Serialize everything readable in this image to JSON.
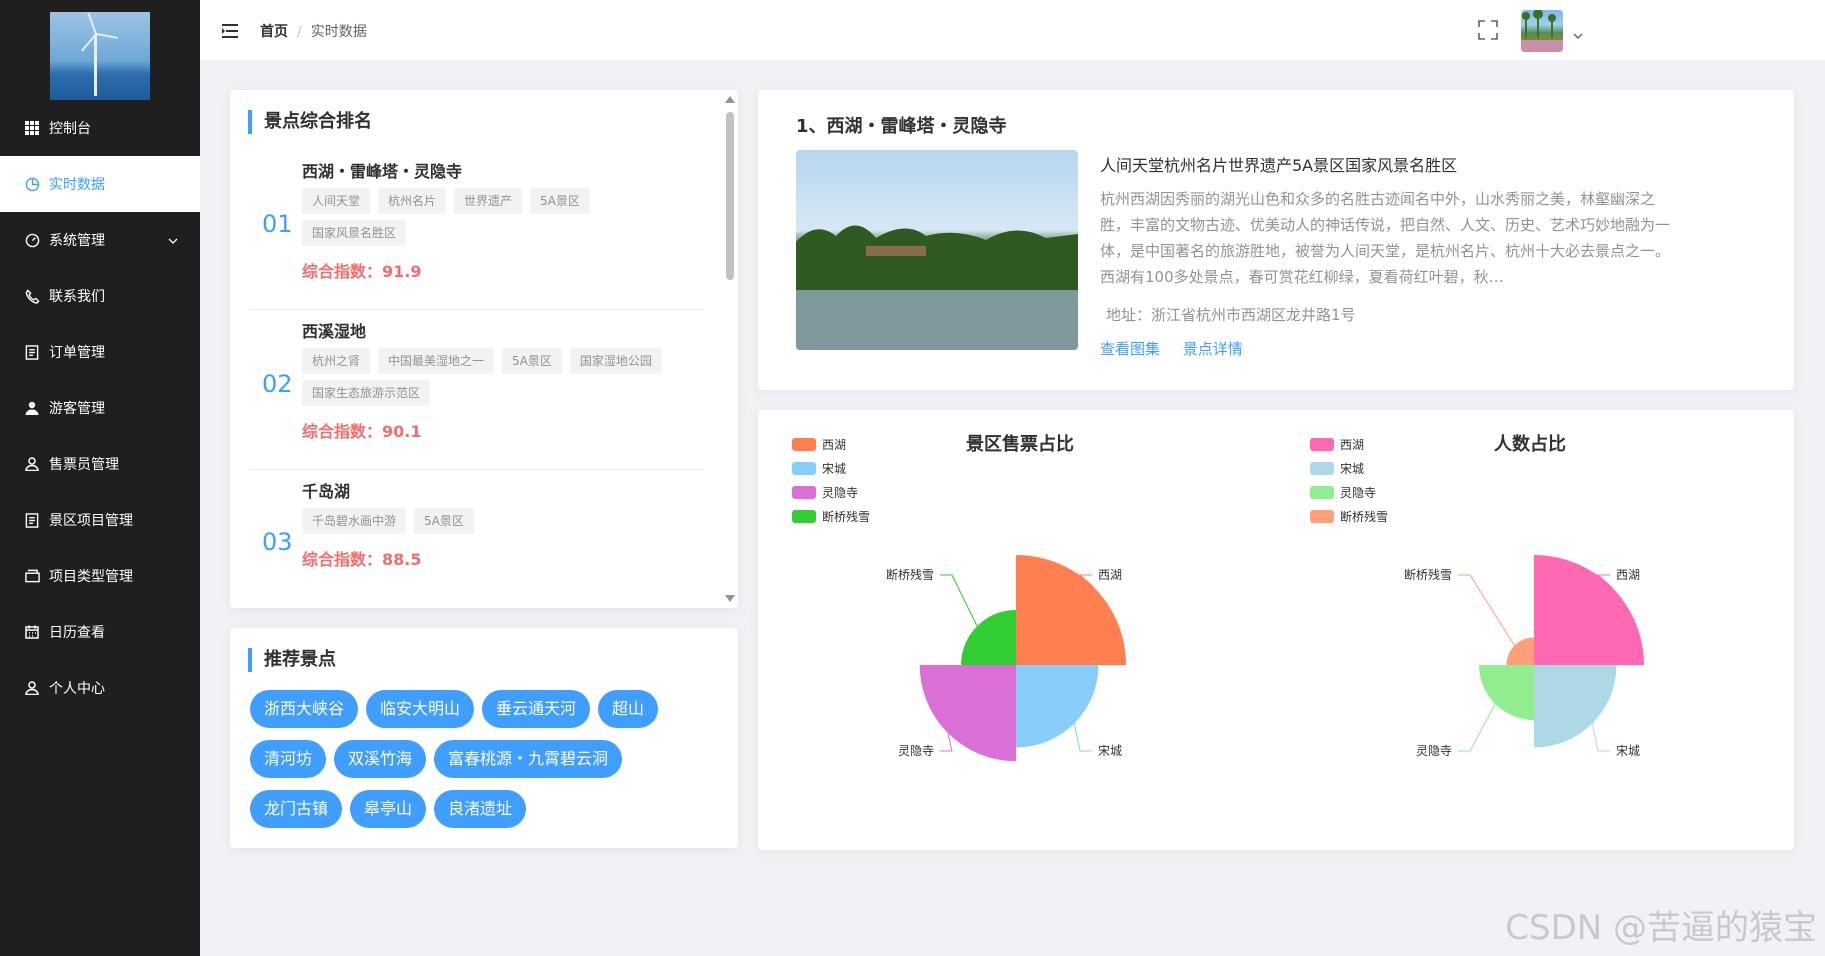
{
  "sidebar": {
    "items": [
      {
        "label": "控制台",
        "icon": "grid-icon"
      },
      {
        "label": "实时数据",
        "icon": "pie-icon",
        "active": true
      },
      {
        "label": "系统管理",
        "icon": "dashboard-icon",
        "has_submenu": true
      },
      {
        "label": "联系我们",
        "icon": "phone-icon"
      },
      {
        "label": "订单管理",
        "icon": "document-icon"
      },
      {
        "label": "游客管理",
        "icon": "user-solid-icon"
      },
      {
        "label": "售票员管理",
        "icon": "user-icon"
      },
      {
        "label": "景区项目管理",
        "icon": "document-icon"
      },
      {
        "label": "项目类型管理",
        "icon": "box-icon"
      },
      {
        "label": "日历查看",
        "icon": "calendar-icon"
      },
      {
        "label": "个人中心",
        "icon": "user-icon"
      }
    ]
  },
  "breadcrumb": {
    "home": "首页",
    "separator": "/",
    "current": "实时数据"
  },
  "ranking": {
    "title": "景点综合排名",
    "items": [
      {
        "num": "01",
        "name": "西湖・雷峰塔・灵隐寺",
        "tags": [
          "人间天堂",
          "杭州名片",
          "世界遗产",
          "5A景区",
          "国家风景名胜区"
        ],
        "score": "综合指数：91.9"
      },
      {
        "num": "02",
        "name": "西溪湿地",
        "tags": [
          "杭州之肾",
          "中国最美湿地之一",
          "5A景区",
          "国家湿地公园",
          "国家生态旅游示范区"
        ],
        "score": "综合指数：90.1"
      },
      {
        "num": "03",
        "name": "千岛湖",
        "tags": [
          "千岛碧水画中游",
          "5A景区"
        ],
        "score": "综合指数：88.5"
      }
    ]
  },
  "recommend": {
    "title": "推荐景点",
    "items": [
      "浙西大峡谷",
      "临安大明山",
      "垂云通天河",
      "超山",
      "清河坊",
      "双溪竹海",
      "富春桃源・九霄碧云洞",
      "龙门古镇",
      "皋亭山",
      "良渚遗址"
    ]
  },
  "detail": {
    "title": "1、西湖・雷峰塔・灵隐寺",
    "slogan": "人间天堂杭州名片世界遗产5A景区国家风景名胜区",
    "description": "杭州西湖因秀丽的湖光山色和众多的名胜古迹闻名中外，山水秀丽之美，林壑幽深之胜，丰富的文物古迹、优美动人的神话传说，把自然、人文、历史、艺术巧妙地融为一体，是中国著名的旅游胜地，被誉为人间天堂，是杭州名片、杭州十大必去景点之一。西湖有100多处景点，春可赏花红柳绿，夏看荷红叶碧，秋…",
    "address": "地址：浙江省杭州市西湖区龙井路1号",
    "links": [
      "查看图集",
      "景点详情"
    ]
  },
  "chart_data": [
    {
      "type": "pie",
      "subtype": "rose",
      "title": "景区售票占比",
      "legend_position": "top-left",
      "categories": [
        "西湖",
        "宋城",
        "灵隐寺",
        "断桥残雪"
      ],
      "values": [
        40,
        30,
        35,
        20
      ],
      "colors": [
        "#ff7f50",
        "#87cefa",
        "#da70d6",
        "#32cd32"
      ]
    },
    {
      "type": "pie",
      "subtype": "rose",
      "title": "人数占比",
      "legend_position": "top-left",
      "categories": [
        "西湖",
        "宋城",
        "灵隐寺",
        "断桥残雪"
      ],
      "values": [
        40,
        30,
        20,
        10
      ],
      "colors": [
        "#ff69b4",
        "#add8e6",
        "#90ee90",
        "#ffa07a"
      ]
    }
  ],
  "watermark": "CSDN @苦逼的猿宝"
}
